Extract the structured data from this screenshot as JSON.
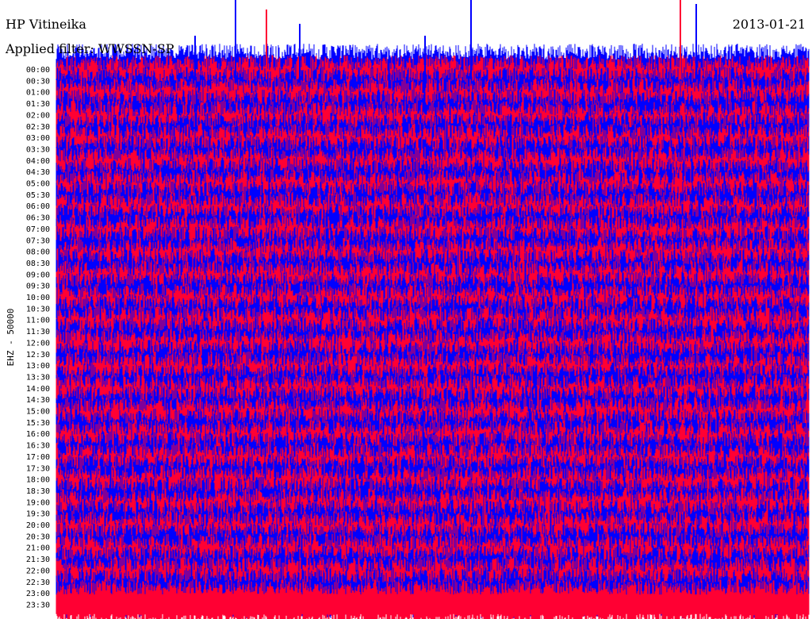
{
  "header": {
    "station": "HP Vitineika",
    "date": "2013-01-21",
    "filter": "Applied filter: WWSSN-SP"
  },
  "chart_data": {
    "type": "line",
    "title": "HP Vitineika",
    "subtitle": "Applied filter: WWSSN-SP",
    "ylabel": "EHZ - 50000",
    "xlabel": "",
    "colors": [
      "#0000ff",
      "#ff0033"
    ],
    "color_pattern": "alternating traces per row",
    "tick_labels": [
      "00:00",
      "00:30",
      "01:00",
      "01:30",
      "02:00",
      "02:30",
      "03:00",
      "03:30",
      "04:00",
      "04:30",
      "05:00",
      "05:30",
      "06:00",
      "06:30",
      "07:00",
      "07:30",
      "08:00",
      "08:30",
      "09:00",
      "09:30",
      "10:00",
      "10:30",
      "11:00",
      "11:30",
      "12:00",
      "12:30",
      "13:00",
      "13:30",
      "14:00",
      "14:30",
      "15:00",
      "15:30",
      "16:00",
      "16:30",
      "17:00",
      "17:30",
      "18:00",
      "18:30",
      "19:00",
      "19:30",
      "20:00",
      "20:30",
      "21:00",
      "21:30",
      "22:00",
      "22:30",
      "23:00",
      "23:30"
    ],
    "grid": false,
    "legend": "none"
  }
}
